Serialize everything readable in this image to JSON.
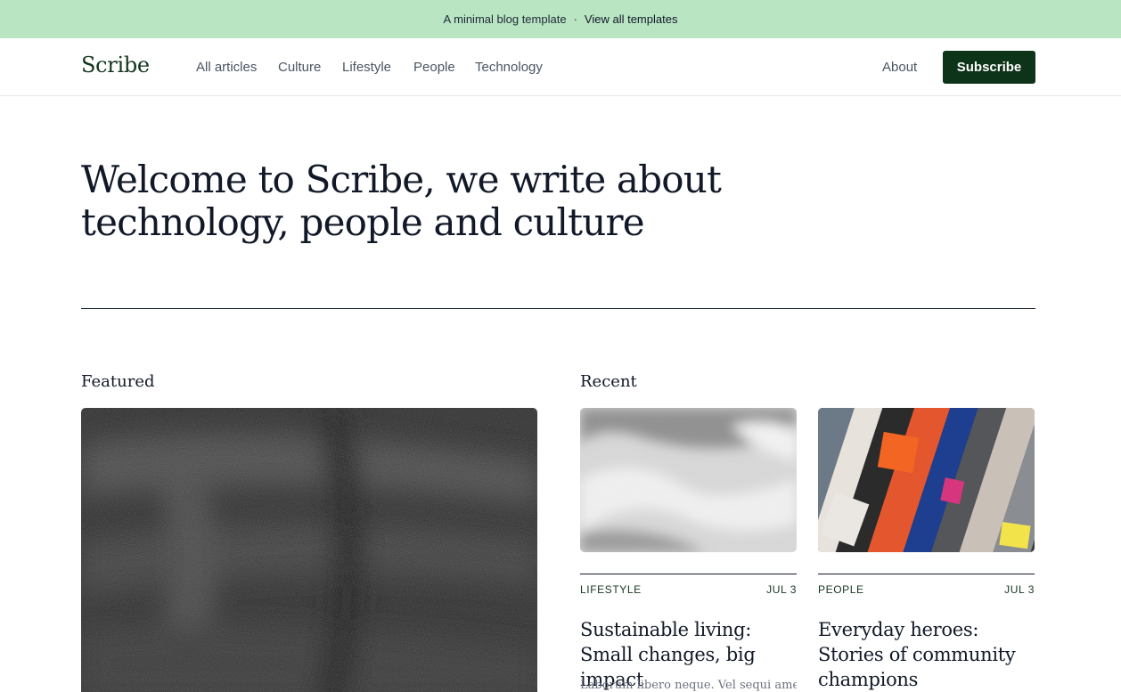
{
  "banner": {
    "text": "A minimal blog template",
    "separator": "·",
    "link_label": "View all templates"
  },
  "header": {
    "logo": "Scribe",
    "nav": [
      "All articles",
      "Culture",
      "Lifestyle",
      "People",
      "Technology"
    ],
    "about_label": "About",
    "subscribe_label": "Subscribe"
  },
  "hero": {
    "line1": "Welcome to Scribe, we write about",
    "line2": "technology, people and culture"
  },
  "featured": {
    "heading": "Featured"
  },
  "recent": {
    "heading": "Recent",
    "cards": [
      {
        "category": "LIFESTYLE",
        "date": "JUL 3",
        "title": "Sustainable living: Small changes, big impact",
        "excerpt": "Laborum libero neque. Vel sequi amet"
      },
      {
        "category": "PEOPLE",
        "date": "JUL 3",
        "title": "Everyday heroes: Stories of community champions",
        "excerpt": ""
      }
    ]
  },
  "colors": {
    "banner_bg": "#b9e5c3",
    "brand_dark": "#0d3318",
    "text": "#111827",
    "muted": "#4b5563"
  }
}
